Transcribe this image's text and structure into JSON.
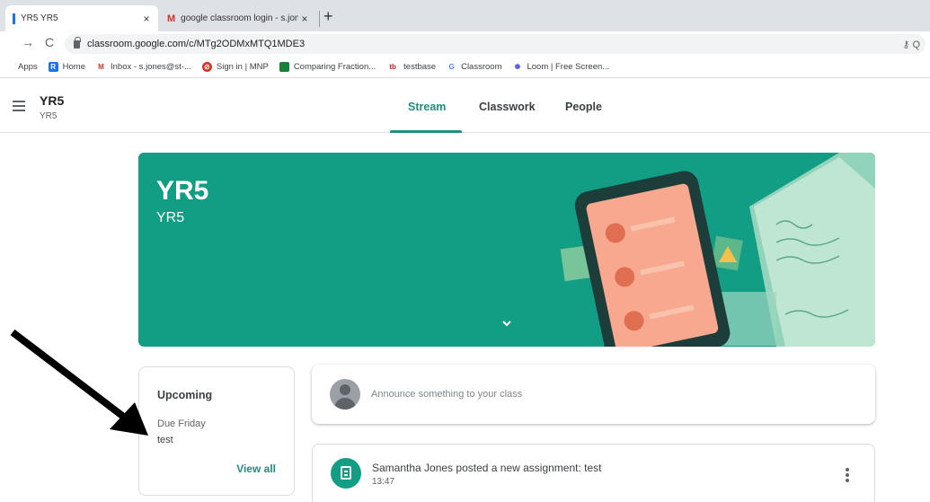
{
  "browser": {
    "tabs": [
      {
        "title": "YR5 YR5",
        "close": "×"
      },
      {
        "title": "google classroom login - s.jones",
        "close": "×"
      }
    ],
    "new_tab": "+",
    "back": "→",
    "reload": "C",
    "url": "classroom.google.com/c/MTg2ODMxMTQ1MDE3",
    "url_right": "⚷  Q",
    "bookmarks": [
      {
        "label": "Apps",
        "icon": "apps-icon"
      },
      {
        "label": "Home",
        "icon": "r-logo-icon"
      },
      {
        "label": "Inbox - s.jones@st-...",
        "icon": "gmail-icon"
      },
      {
        "label": "Sign in | MNP",
        "icon": "mnp-icon"
      },
      {
        "label": "Comparing Fraction...",
        "icon": "fraction-icon"
      },
      {
        "label": "testbase",
        "icon": "tb-icon"
      },
      {
        "label": "Classroom",
        "icon": "google-g-icon"
      },
      {
        "label": "Loom | Free Screen...",
        "icon": "loom-icon"
      }
    ]
  },
  "classroom": {
    "class_name": "YR5",
    "class_section": "YR5",
    "tabs": [
      {
        "label": "Stream",
        "active": true
      },
      {
        "label": "Classwork",
        "active": false
      },
      {
        "label": "People",
        "active": false
      }
    ],
    "banner": {
      "title": "YR5",
      "subtitle": "YR5",
      "color": "#129e85"
    },
    "upcoming": {
      "title": "Upcoming",
      "due": "Due Friday",
      "item": "test",
      "view_all": "View all"
    },
    "announce_placeholder": "Announce something to your class",
    "post": {
      "title": "Samantha Jones posted a new assignment: test",
      "time": "13:47"
    },
    "accent": "#1e8e7e"
  }
}
